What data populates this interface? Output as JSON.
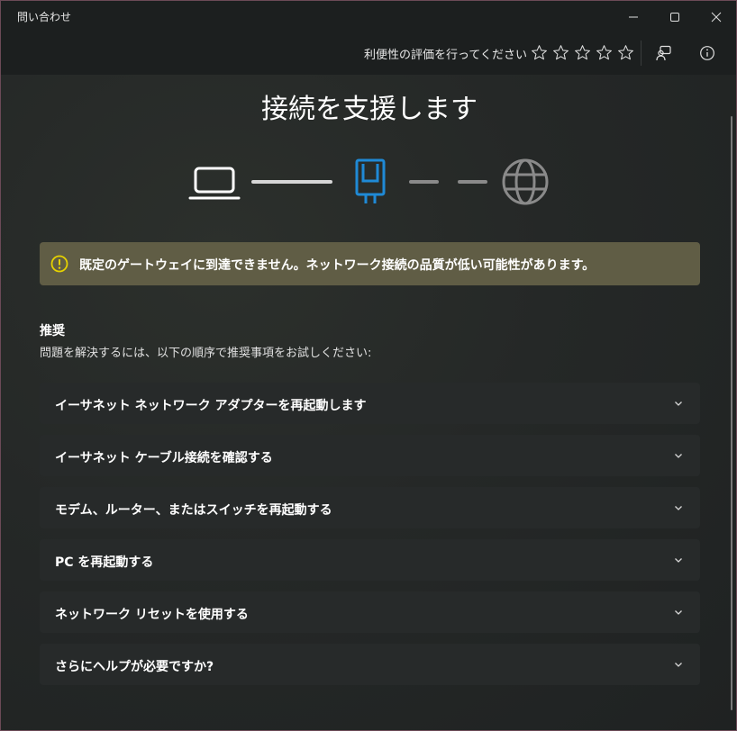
{
  "window": {
    "title": "問い合わせ"
  },
  "commandbar": {
    "rating_label": "利便性の評価を行ってください",
    "star_count": 5
  },
  "main": {
    "heading": "接続を支援します",
    "diagram": {
      "nodes": [
        "laptop-icon",
        "ethernet-adapter-icon",
        "globe-icon"
      ],
      "accent": "#1f8ad6"
    },
    "warning": {
      "text": "既定のゲートウェイに到達できません。ネットワーク接続の品質が低い可能性があります。",
      "color": "#e6d200"
    },
    "recommendations": {
      "title": "推奨",
      "description": "問題を解決するには、以下の順序で推奨事項をお試しください:",
      "items": [
        "イーサネット ネットワーク アダプターを再起動します",
        "イーサネット ケーブル接続を確認する",
        "モデム、ルーター、またはスイッチを再起動する",
        "PC を再起動する",
        "ネットワーク リセットを使用する",
        "さらにヘルプが必要ですか?"
      ]
    }
  }
}
